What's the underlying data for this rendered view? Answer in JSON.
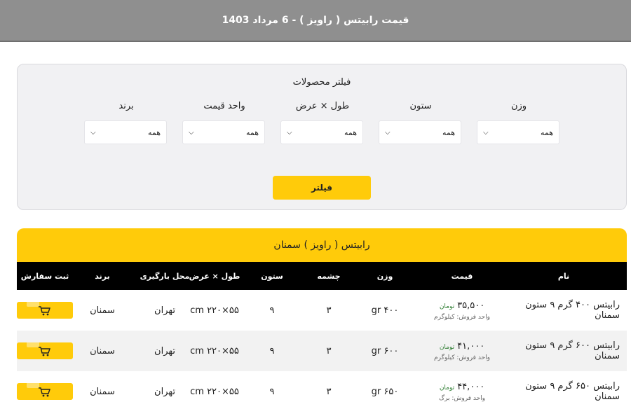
{
  "topbar": {
    "title": "قیمت رابیتس ( راویز ) - 6 مرداد 1403"
  },
  "filter": {
    "title": "فیلتر محصولات",
    "fields": [
      {
        "label": "برند",
        "value": "همه"
      },
      {
        "label": "واحد قیمت",
        "value": "همه"
      },
      {
        "label": "طول × عرض",
        "value": "همه"
      },
      {
        "label": "ستون",
        "value": "همه"
      },
      {
        "label": "وزن",
        "value": "همه"
      }
    ],
    "button_label": "فیلتر"
  },
  "product_group": {
    "title": "رابیتس ( راویز )  سمنان",
    "columns": {
      "name": "نام",
      "price": "قیمت",
      "weight": "وزن",
      "hole": "چشمه",
      "column": "ستون",
      "size": "طول × عرض",
      "loading_place": "محل بارگیری",
      "brand": "برند",
      "order": "ثبت سفارش"
    },
    "rows": [
      {
        "name": "رابیتس ۴۰۰ گرم ۹ ستون سمنان",
        "price": "۳۵,۵۰۰",
        "currency": "تومان",
        "sale_unit": "واحد فروش: کیلوگرم",
        "weight": "۴۰۰ gr",
        "hole": "۳",
        "column": "۹",
        "size": "۵۵×۲۲۰ cm",
        "loading_place": "تهران",
        "brand": "سمنان"
      },
      {
        "name": "رابیتس ۶۰۰ گرم ۹ ستون سمنان",
        "price": "۴۱,۰۰۰",
        "currency": "تومان",
        "sale_unit": "واحد فروش: کیلوگرم",
        "weight": "۶۰۰ gr",
        "hole": "۳",
        "column": "۹",
        "size": "۵۵×۲۲۰ cm",
        "loading_place": "تهران",
        "brand": "سمنان"
      },
      {
        "name": "رابیتس ۶۵۰ گرم ۹ ستون سمنان",
        "price": "۴۴,۰۰۰",
        "currency": "تومان",
        "sale_unit": "واحد فروش: برگ",
        "weight": "۶۵۰ gr",
        "hole": "۳",
        "column": "۹",
        "size": "۵۵×۲۲۰ cm",
        "loading_place": "تهران",
        "brand": "سمنان"
      }
    ]
  },
  "colors": {
    "accent": "#ffcb0a",
    "topbar": "#8f8f8f",
    "price_unit": "#2e7d32"
  },
  "icons": {
    "order": "cart-icon",
    "select": "chevron-down-icon"
  }
}
